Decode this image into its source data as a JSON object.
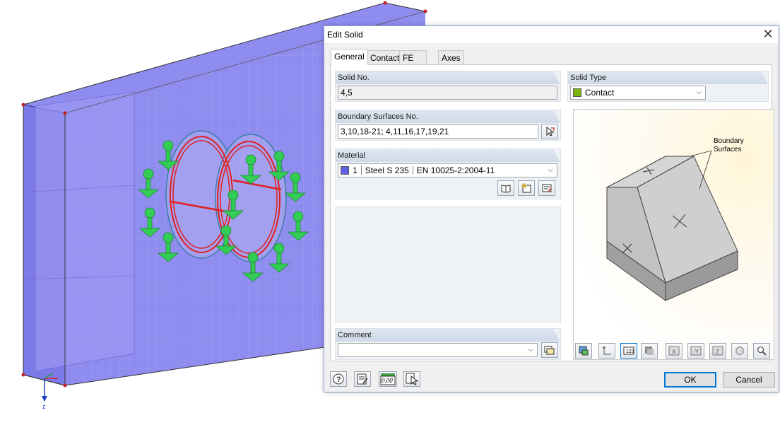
{
  "dialog": {
    "title": "Edit Solid",
    "tabs": [
      "General",
      "Contact",
      "FE Mesh",
      "Axes"
    ],
    "solid_no": {
      "label": "Solid No.",
      "value": "4,5"
    },
    "solid_type": {
      "label": "Solid Type",
      "value": "Contact",
      "swatch": "#7cb500"
    },
    "boundary": {
      "label": "Boundary Surfaces No.",
      "value": "3,10,18-21; 4,11,16,17,19,21"
    },
    "material": {
      "label": "Material",
      "number": "1",
      "name": "Steel S 235",
      "standard": "EN 10025-2:2004-11",
      "swatch": "#6060e8"
    },
    "comment": {
      "label": "Comment",
      "value": ""
    },
    "preview": {
      "annotation_line1": "Boundary",
      "annotation_line2": "Surfaces"
    },
    "buttons": {
      "ok": "OK",
      "cancel": "Cancel",
      "units_value": "0.00"
    }
  },
  "viewport": {
    "axis_label": "z"
  },
  "colors": {
    "model_fill": "#8f8cf0",
    "load_green": "#33cc55",
    "highlight_red": "#e02020",
    "accent_blue": "#0078d7"
  }
}
